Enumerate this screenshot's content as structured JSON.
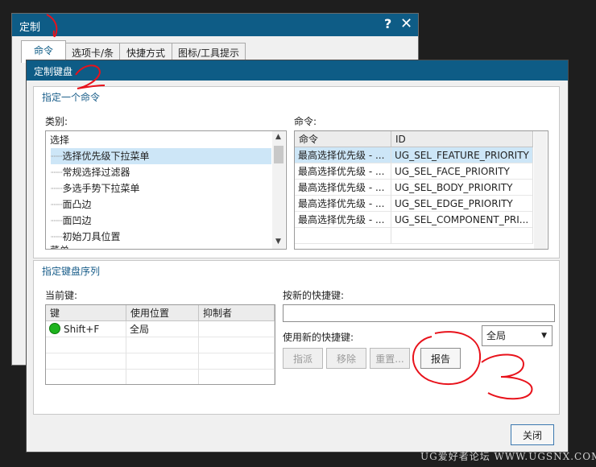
{
  "back_window": {
    "title": "定制",
    "help_label": "?",
    "close_label": "✕",
    "tabs": [
      {
        "label": "命令"
      },
      {
        "label": "选项卡/条"
      },
      {
        "label": "快捷方式"
      },
      {
        "label": "图标/工具提示"
      }
    ]
  },
  "dialog": {
    "title": "定制键盘",
    "specify_command": {
      "group_title": "指定一个命令",
      "category_label": "类别:",
      "categories": {
        "root": "选择",
        "items": [
          "选择优先级下拉菜单",
          "常规选择过滤器",
          "多选手势下拉菜单",
          "面凸边",
          "面凹边",
          "初始刀具位置"
        ],
        "partial": "菜单"
      },
      "command_label": "命令:",
      "command_headers": {
        "command": "命令",
        "id": "ID"
      },
      "commands": [
        {
          "command": "最高选择优先级 - ...",
          "id": "UG_SEL_FEATURE_PRIORITY"
        },
        {
          "command": "最高选择优先级 - ...",
          "id": "UG_SEL_FACE_PRIORITY"
        },
        {
          "command": "最高选择优先级 - ...",
          "id": "UG_SEL_BODY_PRIORITY"
        },
        {
          "command": "最高选择优先级 - ...",
          "id": "UG_SEL_EDGE_PRIORITY"
        },
        {
          "command": "最高选择优先级 - ...",
          "id": "UG_SEL_COMPONENT_PRI..."
        }
      ]
    },
    "key_sequence": {
      "group_title": "指定键盘序列",
      "current_keys_label": "当前键:",
      "headers": {
        "key": "键",
        "location": "使用位置",
        "suppressor": "抑制者"
      },
      "rows": [
        {
          "key": "Shift+F",
          "location": "全局",
          "suppressor": ""
        }
      ],
      "new_shortcut_label": "按新的快捷键:",
      "new_shortcut_value": "",
      "use_new_label": "使用新的快捷键:",
      "scope_value": "全局",
      "buttons": {
        "assign": "指派",
        "remove": "移除",
        "reset": "重置...",
        "report": "报告"
      }
    },
    "close_button": "关闭"
  },
  "watermark": "UG爱好者论坛 WWW.UGSNX.COM",
  "colors": {
    "titlebar": "#0e5c86",
    "selection": "#cde6f7",
    "status_green": "#1db31d",
    "annotation": "#e8121b"
  }
}
